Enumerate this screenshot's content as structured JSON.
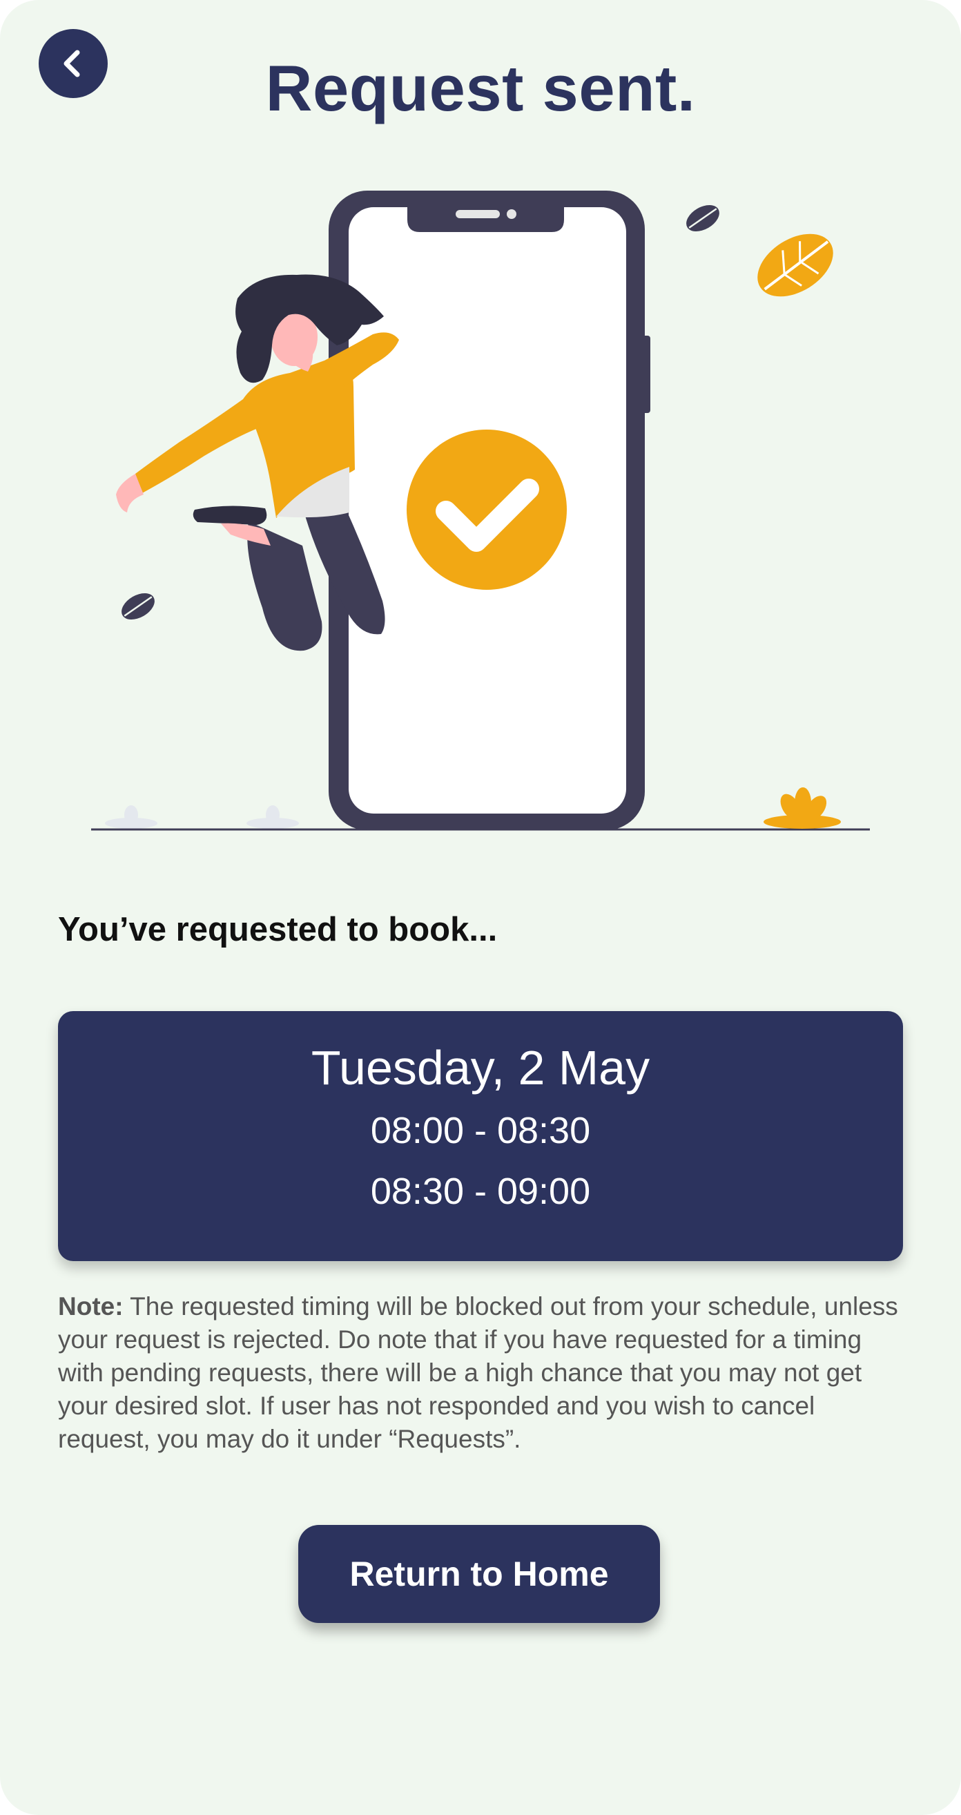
{
  "header": {
    "title": "Request sent.",
    "back_icon": "chevron-left-icon"
  },
  "illustration": {
    "icon": "phone-check-illustration",
    "check_color": "#f2a814",
    "phone_color": "#3f3d56"
  },
  "booking": {
    "heading": "You’ve requested to book...",
    "date": "Tuesday, 2 May",
    "slots": [
      "08:00 - 08:30",
      "08:30 - 09:00"
    ]
  },
  "note": {
    "label": "Note:",
    "text": "The requested timing will be blocked out from your schedule, unless your request is rejected. Do note that if you have requested for a timing with pending requests, there will be a high chance that you may not get your desired slot. If user has not responded and you wish to cancel request, you may do it under “Requests”."
  },
  "actions": {
    "home_label": "Return to Home"
  },
  "colors": {
    "background": "#f0f7ef",
    "primary": "#2c335e",
    "accent": "#f2a814"
  }
}
